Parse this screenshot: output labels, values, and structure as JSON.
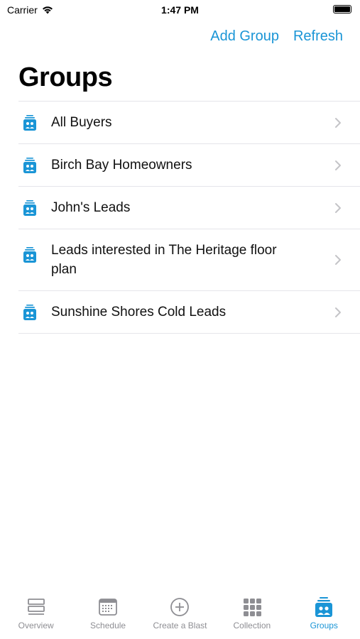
{
  "status_bar": {
    "carrier": "Carrier",
    "time": "1:47 PM"
  },
  "nav": {
    "add_group": "Add Group",
    "refresh": "Refresh"
  },
  "title": "Groups",
  "groups": [
    {
      "label": "All Buyers"
    },
    {
      "label": "Birch Bay Homeowners"
    },
    {
      "label": "John's Leads"
    },
    {
      "label": "Leads interested in The Heritage floor plan"
    },
    {
      "label": "Sunshine Shores Cold Leads"
    }
  ],
  "tabs": [
    {
      "label": "Overview",
      "icon": "overview-icon",
      "active": false
    },
    {
      "label": "Schedule",
      "icon": "calendar-icon",
      "active": false
    },
    {
      "label": "Create a Blast",
      "icon": "plus-circle-icon",
      "active": false
    },
    {
      "label": "Collection",
      "icon": "grid-icon",
      "active": false
    },
    {
      "label": "Groups",
      "icon": "groups-icon",
      "active": true
    }
  ],
  "colors": {
    "accent": "#1a95d6",
    "inactive": "#8e8e93",
    "separator": "#e5e5ea"
  }
}
